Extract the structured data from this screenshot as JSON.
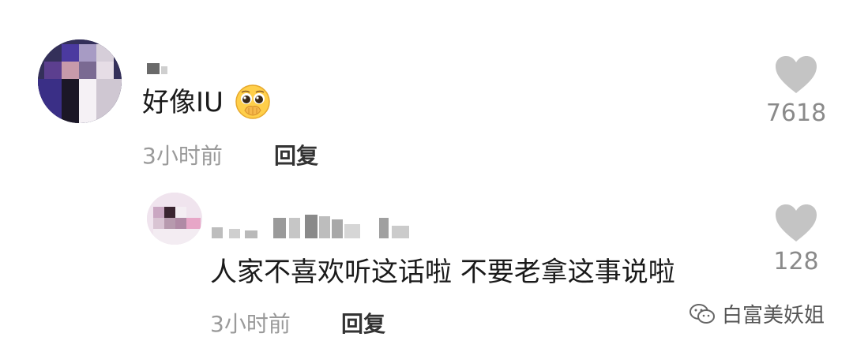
{
  "comments": [
    {
      "text": "好像IU",
      "emoji": "pleading-face-hands-over-mouth",
      "time": "3小时前",
      "reply_label": "回复",
      "likes": "7618"
    },
    {
      "text": "人家不喜欢听这话啦 不要老拿这事说啦",
      "time": "3小时前",
      "reply_label": "回复",
      "likes": "128"
    }
  ],
  "watermark": {
    "text": "白富美妖姐",
    "icon": "wechat-icon"
  },
  "colors": {
    "heart": "#c4c4c4",
    "time": "#9a9a9a",
    "text": "#1a1a1a"
  }
}
